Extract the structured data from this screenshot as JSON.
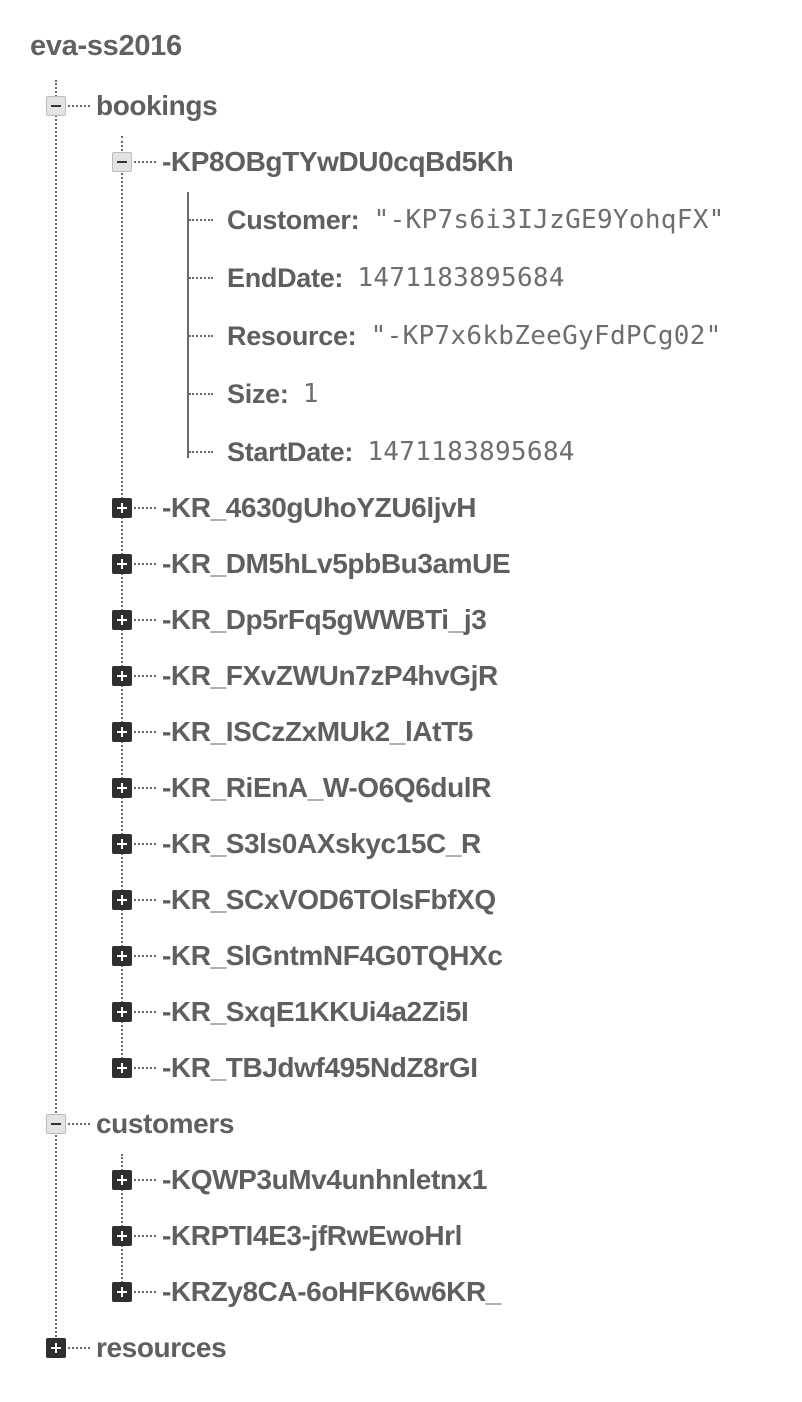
{
  "root": {
    "name": "eva-ss2016"
  },
  "bookings": {
    "label": "bookings",
    "expanded_key": {
      "label": "-KP8OBgTYwDU0cqBd5Kh",
      "fields": [
        {
          "key": "Customer",
          "value": "\"-KP7s6i3IJzGE9YohqFX\""
        },
        {
          "key": "EndDate",
          "value": "1471183895684"
        },
        {
          "key": "Resource",
          "value": "\"-KP7x6kbZeeGyFdPCg02\""
        },
        {
          "key": "Size",
          "value": "1"
        },
        {
          "key": "StartDate",
          "value": "1471183895684"
        }
      ]
    },
    "collapsed_keys": [
      "-KR_4630gUhoYZU6ljvH",
      "-KR_DM5hLv5pbBu3amUE",
      "-KR_Dp5rFq5gWWBTi_j3",
      "-KR_FXvZWUn7zP4hvGjR",
      "-KR_ISCzZxMUk2_lAtT5",
      "-KR_RiEnA_W-O6Q6dulR",
      "-KR_S3ls0AXskyc15C_R",
      "-KR_SCxVOD6TOlsFbfXQ",
      "-KR_SlGntmNF4G0TQHXc",
      "-KR_SxqE1KKUi4a2Zi5I",
      "-KR_TBJdwf495NdZ8rGI"
    ]
  },
  "customers": {
    "label": "customers",
    "collapsed_keys": [
      "-KQWP3uMv4unhnletnx1",
      "-KRPTI4E3-jfRwEwoHrl",
      "-KRZy8CA-6oHFK6w6KR_"
    ]
  },
  "resources": {
    "label": "resources"
  },
  "colors": {
    "text": "#5f5f5f",
    "value_text": "#6e6e6e",
    "collapsed_toggle": "#2f2f2f",
    "expanded_toggle": "#e3e3e3"
  }
}
